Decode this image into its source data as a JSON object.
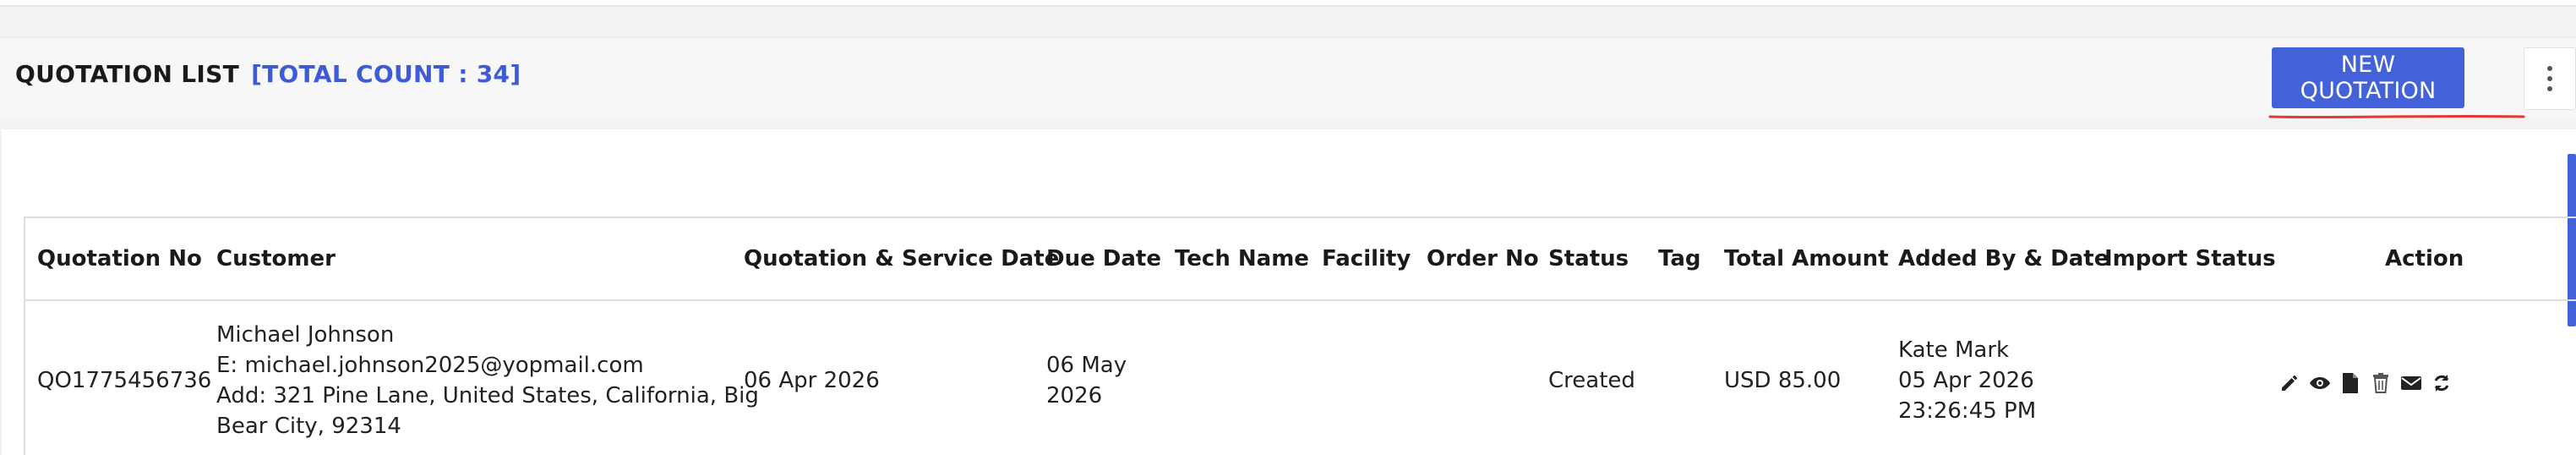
{
  "header": {
    "title": "QUOTATION LIST",
    "count_label": "[TOTAL COUNT : 34]",
    "new_button": "NEW QUOTATION"
  },
  "table": {
    "columns": [
      "Quotation No",
      "Customer",
      "Quotation & Service Date",
      "Due Date",
      "Tech Name",
      "Facility",
      "Order No",
      "Status",
      "Tag",
      "Total Amount",
      "Added By & Date",
      "Import Status",
      "Action"
    ],
    "rows": [
      {
        "quotation_no": "QO1775456736",
        "customer_name": "Michael Johnson",
        "customer_email": "E: michael.johnson2025@yopmail.com",
        "customer_address_1": "Add: 321 Pine Lane, United States, California, Big",
        "customer_address_2": "Bear City, 92314",
        "service_date": "06 Apr 2026",
        "due_date_1": "06 May",
        "due_date_2": "2026",
        "tech_name": "",
        "facility": "",
        "order_no": "",
        "status": "Created",
        "tag": "",
        "total_amount": "USD 85.00",
        "added_by": "Kate Mark",
        "added_date": "05 Apr 2026",
        "added_time": "23:26:45 PM",
        "import_status": "",
        "actions": [
          "edit-icon",
          "view-icon",
          "document-icon",
          "delete-icon",
          "email-icon",
          "refresh-icon"
        ]
      }
    ]
  },
  "colors": {
    "accent": "#4361d8",
    "count": "#3d5bd9",
    "highlight_underline": "#e53935"
  }
}
